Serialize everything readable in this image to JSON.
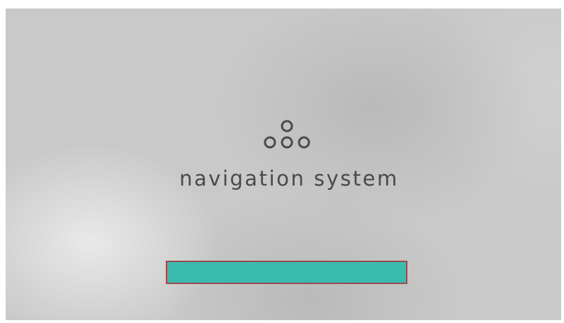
{
  "screen": {
    "logo_icon": "three-plus-one-circles-logo-icon",
    "title": "navigation system",
    "progress": {
      "fraction": 1.0,
      "fill_color": "#39bcae",
      "border_color": "#9b4a50"
    }
  }
}
